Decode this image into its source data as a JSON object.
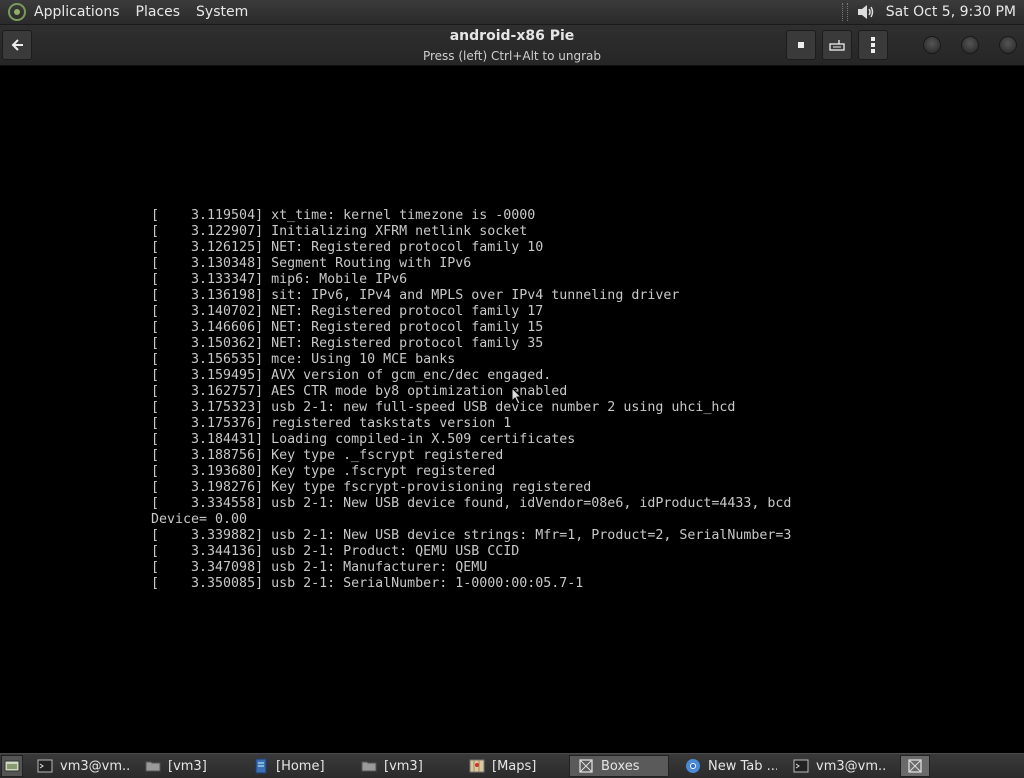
{
  "top_panel": {
    "menus": [
      "Applications",
      "Places",
      "System"
    ],
    "clock": "Sat Oct  5,  9:30 PM"
  },
  "window": {
    "title": "android-x86 Pie",
    "subtitle": "Press (left) Ctrl+Alt to ungrab"
  },
  "console_lines": [
    "[    3.119504] xt_time: kernel timezone is -0000",
    "[    3.122907] Initializing XFRM netlink socket",
    "[    3.126125] NET: Registered protocol family 10",
    "[    3.130348] Segment Routing with IPv6",
    "[    3.133347] mip6: Mobile IPv6",
    "[    3.136198] sit: IPv6, IPv4 and MPLS over IPv4 tunneling driver",
    "[    3.140702] NET: Registered protocol family 17",
    "[    3.146606] NET: Registered protocol family 15",
    "[    3.150362] NET: Registered protocol family 35",
    "[    3.156535] mce: Using 10 MCE banks",
    "[    3.159495] AVX version of gcm_enc/dec engaged.",
    "[    3.162757] AES CTR mode by8 optimization enabled",
    "[    3.175323] usb 2-1: new full-speed USB device number 2 using uhci_hcd",
    "[    3.175376] registered taskstats version 1",
    "[    3.184431] Loading compiled-in X.509 certificates",
    "[    3.188756] Key type ._fscrypt registered",
    "[    3.193680] Key type .fscrypt registered",
    "[    3.198276] Key type fscrypt-provisioning registered",
    "[    3.334558] usb 2-1: New USB device found, idVendor=08e6, idProduct=4433, bcd",
    "Device= 0.00",
    "[    3.339882] usb 2-1: New USB device strings: Mfr=1, Product=2, SerialNumber=3",
    "[    3.344136] usb 2-1: Product: QEMU USB CCID",
    "[    3.347098] usb 2-1: Manufacturer: QEMU",
    "[    3.350085] usb 2-1: SerialNumber: 1-0000:00:05.7-1"
  ],
  "taskbar": {
    "tasks": [
      {
        "label": "vm3@vm...",
        "icon": "terminal-icon"
      },
      {
        "label": "[vm3]",
        "icon": "folder-icon"
      },
      {
        "label": "[Home]",
        "icon": "document-icon"
      },
      {
        "label": "[vm3]",
        "icon": "folder-icon"
      },
      {
        "label": "[Maps]",
        "icon": "maps-icon"
      },
      {
        "label": "Boxes",
        "icon": "boxes-icon",
        "active": true
      },
      {
        "label": "New Tab ...",
        "icon": "browser-icon"
      },
      {
        "label": "vm3@vm...",
        "icon": "terminal-icon"
      }
    ]
  },
  "colors": {
    "console_text": "#c8c8c8",
    "panel_bg": "#333333",
    "background": "#000000"
  }
}
